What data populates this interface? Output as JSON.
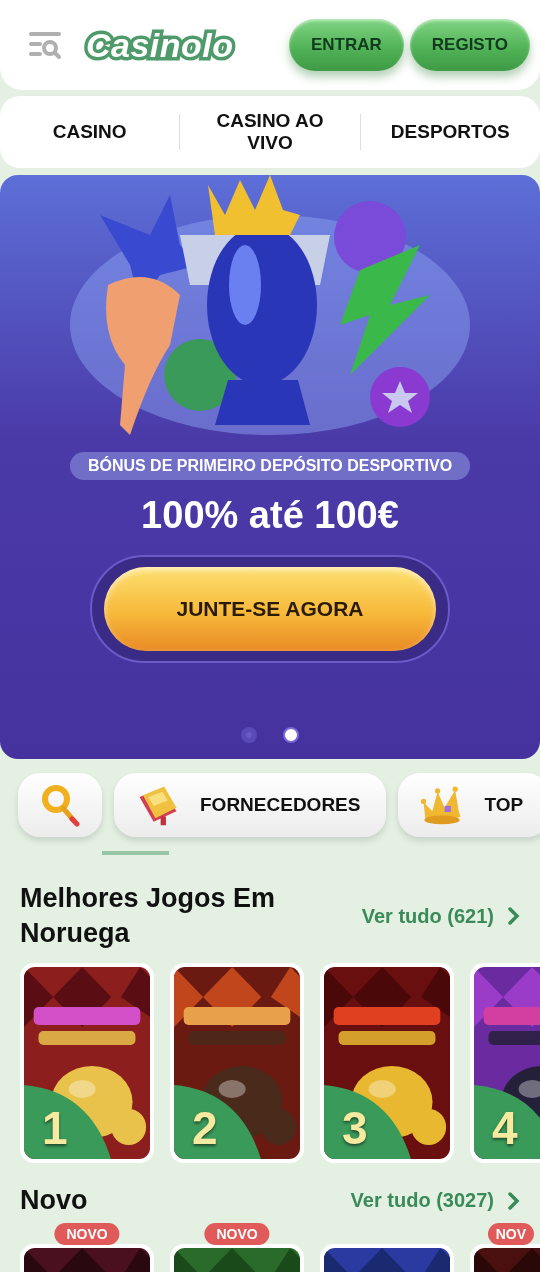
{
  "header": {
    "logo": "Casinolo",
    "buttons": [
      {
        "label": "ENTRAR"
      },
      {
        "label": "REGISTO"
      }
    ]
  },
  "nav": [
    {
      "label": "CASINO"
    },
    {
      "label": "CASINO AO VIVO"
    },
    {
      "label": "DESPORTOS"
    }
  ],
  "banner": {
    "picture": {
      "kind": "picture"
    },
    "tag": "BÓNUS DE PRIMEIRO DEPÓSITO DESPORTIVO",
    "headline": "100% até 100€",
    "cta": "JUNTE-SE AGORA",
    "dots": [
      {
        "selected": false
      },
      {
        "selected": true
      }
    ]
  },
  "categories": [
    {
      "kind": "search"
    },
    {
      "kind": "book",
      "label": "FORNECEDORES"
    },
    {
      "kind": "crown",
      "label": "TOP"
    }
  ],
  "sections": [
    {
      "title": "Melhores Jogos Em Noruega",
      "link": "Ver tudo (621)",
      "games": [
        {
          "kind": "picture",
          "rank": "1"
        },
        {
          "kind": "picture",
          "rank": "2"
        },
        {
          "kind": "picture",
          "rank": "3"
        },
        {
          "kind": "picture",
          "rank": "4"
        }
      ]
    },
    {
      "title": "Novo",
      "link": "Ver tudo (3027)",
      "games": [
        {
          "kind": "picture",
          "badge": "NOVO"
        },
        {
          "kind": "picture",
          "badge": "NOVO"
        },
        {
          "kind": "picture"
        },
        {
          "kind": "picture",
          "badge": "NOV"
        }
      ]
    }
  ]
}
